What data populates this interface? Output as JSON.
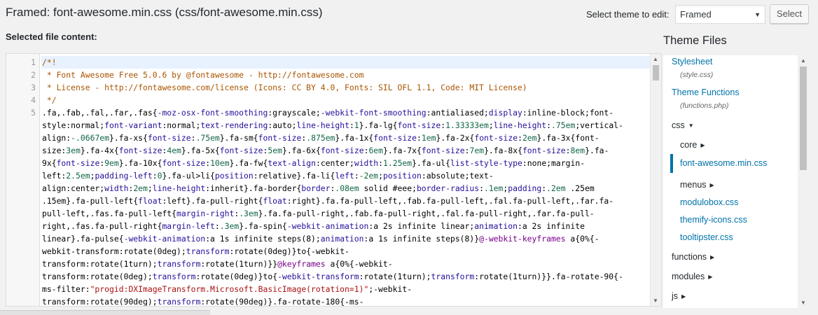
{
  "header": {
    "title": "Framed: font-awesome.min.css (css/font-awesome.min.css)",
    "selected_file_label": "Selected file content:",
    "theme_label": "Select theme to edit:",
    "theme_value": "Framed",
    "select_button": "Select"
  },
  "editor": {
    "line_numbers": [
      "1",
      "2",
      "3",
      "4",
      "5"
    ],
    "lines": [
      "/*!",
      " * Font Awesome Free 5.0.6 by @fontawesome - http://fontawesome.com",
      " * License - http://fontawesome.com/license (Icons: CC BY 4.0, Fonts: SIL OFL 1.1, Code: MIT License)",
      " */",
      ".fa,.fab,.fal,.far,.fas{-moz-osx-font-smoothing:grayscale;-webkit-font-smoothing:antialiased;display:inline-block;font-",
      "style:normal;font-variant:normal;text-rendering:auto;line-height:1}.fa-lg{font-size:1.33333em;line-height:.75em;vertical-",
      "align:-.0667em}.fa-xs{font-size:.75em}.fa-sm{font-size:.875em}.fa-1x{font-size:1em}.fa-2x{font-size:2em}.fa-3x{font-",
      "size:3em}.fa-4x{font-size:4em}.fa-5x{font-size:5em}.fa-6x{font-size:6em}.fa-7x{font-size:7em}.fa-8x{font-size:8em}.fa-",
      "9x{font-size:9em}.fa-10x{font-size:10em}.fa-fw{text-align:center;width:1.25em}.fa-ul{list-style-type:none;margin-",
      "left:2.5em;padding-left:0}.fa-ul>li{position:relative}.fa-li{left:-2em;position:absolute;text-",
      "align:center;width:2em;line-height:inherit}.fa-border{border:.08em solid #eee;border-radius:.1em;padding:.2em .25em",
      ".15em}.fa-pull-left{float:left}.fa-pull-right{float:right}.fa.fa-pull-left,.fab.fa-pull-left,.fal.fa-pull-left,.far.fa-",
      "pull-left,.fas.fa-pull-left{margin-right:.3em}.fa.fa-pull-right,.fab.fa-pull-right,.fal.fa-pull-right,.far.fa-pull-",
      "right,.fas.fa-pull-right{margin-left:.3em}.fa-spin{-webkit-animation:a 2s infinite linear;animation:a 2s infinite",
      "linear}.fa-pulse{-webkit-animation:a 1s infinite steps(8);animation:a 1s infinite steps(8)}@-webkit-keyframes a{0%{-",
      "webkit-transform:rotate(0deg);transform:rotate(0deg)}to{-webkit-",
      "transform:rotate(1turn);transform:rotate(1turn)}}@keyframes a{0%{-webkit-",
      "transform:rotate(0deg);transform:rotate(0deg)}to{-webkit-transform:rotate(1turn);transform:rotate(1turn)}}.fa-rotate-90{-",
      "ms-filter:\"progid:DXImageTransform.Microsoft.BasicImage(rotation=1)\";-webkit-",
      "transform:rotate(90deg);transform:rotate(90deg)}.fa-rotate-180{-ms-"
    ]
  },
  "theme_files": {
    "heading": "Theme Files",
    "stylesheet": "Stylesheet",
    "stylesheet_sub": "(style.css)",
    "functions": "Theme Functions",
    "functions_sub": "(functions.php)",
    "css_folder": "css",
    "core_folder": "core",
    "active_file": "font-awesome.min.css",
    "menus_folder": "menus",
    "file_modulobox": "modulobox.css",
    "file_themify": "themify-icons.css",
    "file_tooltipster": "tooltipster.css",
    "functions_folder": "functions",
    "modules_folder": "modules",
    "js_folder": "js"
  },
  "icons": {
    "dropdown": "triangle-down-icon",
    "folder_open": "triangle-down-icon",
    "folder_closed": "triangle-right-icon",
    "scroll_up": "scroll-up-icon",
    "scroll_down": "scroll-down-icon"
  },
  "colors": {
    "link": "#0073aa",
    "active_bar": "#0073aa",
    "line_highlight": "#e8f2fe",
    "comment": "#aa5500"
  }
}
